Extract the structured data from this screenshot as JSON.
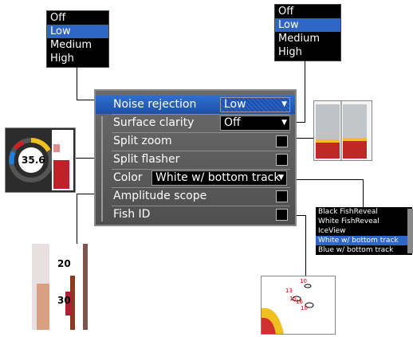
{
  "noise_popup": {
    "options": [
      "Off",
      "Low",
      "Medium",
      "High"
    ],
    "selected": 1
  },
  "surface_popup": {
    "options": [
      "Off",
      "Low",
      "Medium",
      "High"
    ],
    "selected": 1
  },
  "menu": {
    "noise_rejection": {
      "label": "Noise rejection",
      "value": "Low"
    },
    "surface_clarity": {
      "label": "Surface clarity",
      "value": "Off"
    },
    "split_zoom": {
      "label": "Split zoom"
    },
    "split_flasher": {
      "label": "Split flasher"
    },
    "color": {
      "label": "Color",
      "value": "White w/ bottom track"
    },
    "amplitude_scope": {
      "label": "Amplitude scope"
    },
    "fish_id": {
      "label": "Fish ID"
    }
  },
  "color_list": {
    "options": [
      "Black FishReveal",
      "White FishReveal",
      "IceView",
      "White w/ bottom track",
      "Blue w/ bottom track"
    ],
    "selected": 3
  },
  "flasher": {
    "value": "35.6"
  },
  "amplitude": {
    "depth_top": "20",
    "depth_bottom": "30"
  },
  "fish_id": {
    "labels": [
      "10",
      "13",
      "15",
      "16",
      "10"
    ]
  }
}
